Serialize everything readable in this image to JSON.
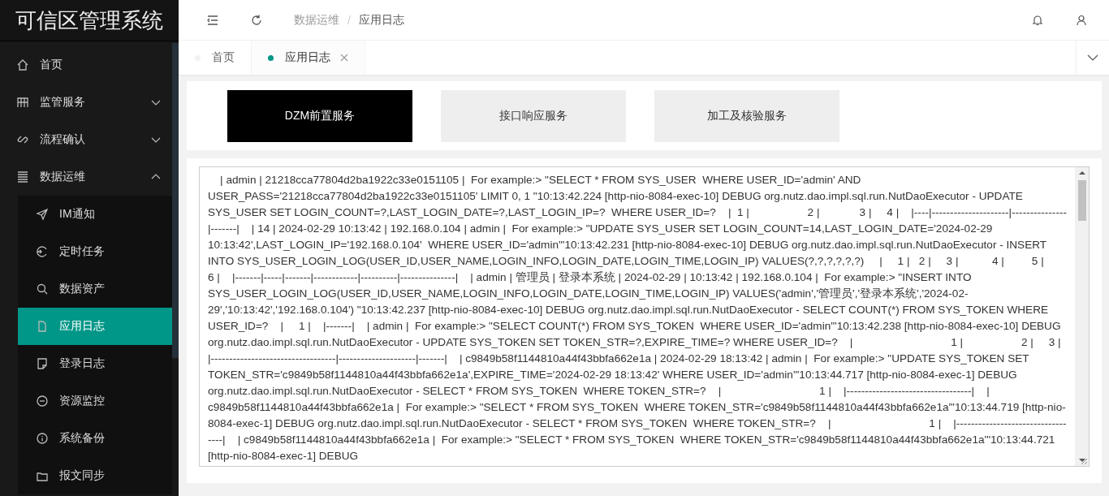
{
  "app_title": "可信区管理系统",
  "sidebar": {
    "items": [
      {
        "label": "首页",
        "kind": "item",
        "selected": false
      },
      {
        "label": "监管服务",
        "kind": "group",
        "expanded": false
      },
      {
        "label": "流程确认",
        "kind": "group",
        "expanded": false
      },
      {
        "label": "数据运维",
        "kind": "group",
        "expanded": true,
        "children": [
          {
            "label": "IM通知",
            "selected": false
          },
          {
            "label": "定时任务",
            "selected": false
          },
          {
            "label": "数据资产",
            "selected": false
          },
          {
            "label": "应用日志",
            "selected": true
          },
          {
            "label": "登录日志",
            "selected": false
          },
          {
            "label": "资源监控",
            "selected": false
          },
          {
            "label": "系统备份",
            "selected": false
          },
          {
            "label": "报文同步",
            "selected": false
          }
        ]
      }
    ]
  },
  "breadcrumb": [
    "数据运维",
    "应用日志"
  ],
  "breadcrumb_separator": "/",
  "tabs": [
    {
      "label": "首页",
      "selected": false,
      "closable": false
    },
    {
      "label": "应用日志",
      "selected": true,
      "closable": true
    }
  ],
  "services": [
    {
      "label": "DZM前置服务",
      "selected": true
    },
    {
      "label": "接口响应服务",
      "selected": false
    },
    {
      "label": "加工及核验服务",
      "selected": false
    }
  ],
  "log": "    | admin | 21218cca77804d2ba1922c33e0151105 |  For example:> \"SELECT * FROM SYS_USER  WHERE USER_ID='admin' AND USER_PASS='21218cca77804d2ba1922c33e0151105' LIMIT 0, 1 \"10:13:42.224 [http-nio-8084-exec-10] DEBUG org.nutz.dao.impl.sql.run.NutDaoExecutor - UPDATE SYS_USER SET LOGIN_COUNT=?,LAST_LOGIN_DATE=?,LAST_LOGIN_IP=?  WHERE USER_ID=?    |  1 |                   2 |             3 |     4 |    |----|---------------------|---------------|-------|    | 14 | 2024-02-29 10:13:42 | 192.168.0.104 | admin |  For example:> \"UPDATE SYS_USER SET LOGIN_COUNT=14,LAST_LOGIN_DATE='2024-02-29 10:13:42',LAST_LOGIN_IP='192.168.0.104'  WHERE USER_ID='admin'\"10:13:42.231 [http-nio-8084-exec-10] DEBUG org.nutz.dao.impl.sql.run.NutDaoExecutor - INSERT INTO SYS_USER_LOGIN_LOG(USER_ID,USER_NAME,LOGIN_INFO,LOGIN_DATE,LOGIN_TIME,LOGIN_IP) VALUES(?,?,?,?,?,?)     |     1 |   2 |     3 |           4 |         5 |             6 |    |-------|-----|-------|------------|----------|---------------|    | admin | 管理员 | 登录本系统 | 2024-02-29 | 10:13:42 | 192.168.0.104 |  For example:> \"INSERT INTO SYS_USER_LOGIN_LOG(USER_ID,USER_NAME,LOGIN_INFO,LOGIN_DATE,LOGIN_TIME,LOGIN_IP) VALUES('admin','管理员','登录本系统','2024-02-29','10:13:42','192.168.0.104') \"10:13:42.237 [http-nio-8084-exec-10] DEBUG org.nutz.dao.impl.sql.run.NutDaoExecutor - SELECT COUNT(*) FROM SYS_TOKEN WHERE USER_ID=?    |     1 |    |-------|    | admin |  For example:> \"SELECT COUNT(*) FROM SYS_TOKEN  WHERE USER_ID='admin'\"10:13:42.238 [http-nio-8084-exec-10] DEBUG org.nutz.dao.impl.sql.run.NutDaoExecutor - UPDATE SYS_TOKEN SET TOKEN_STR=?,EXPIRE_TIME=? WHERE USER_ID=?    |                                1 |                   2 |     3 |    |----------------------------------|---------------------|-------|    | c9849b58f1144810a44f43bbfa662e1a | 2024-02-29 18:13:42 | admin |  For example:> \"UPDATE SYS_TOKEN SET TOKEN_STR='c9849b58f1144810a44f43bbfa662e1a',EXPIRE_TIME='2024-02-29 18:13:42' WHERE USER_ID='admin'\"10:13:44.717 [http-nio-8084-exec-1] DEBUG org.nutz.dao.impl.sql.run.NutDaoExecutor - SELECT * FROM SYS_TOKEN  WHERE TOKEN_STR=?    |                                1 |    |----------------------------------|    | c9849b58f1144810a44f43bbfa662e1a |  For example:> \"SELECT * FROM SYS_TOKEN  WHERE TOKEN_STR='c9849b58f1144810a44f43bbfa662e1a'\"10:13:44.719 [http-nio-8084-exec-1] DEBUG org.nutz.dao.impl.sql.run.NutDaoExecutor - SELECT * FROM SYS_TOKEN  WHERE TOKEN_STR=?    |                                1 |    |----------------------------------|    | c9849b58f1144810a44f43bbfa662e1a |  For example:> \"SELECT * FROM SYS_TOKEN  WHERE TOKEN_STR='c9849b58f1144810a44f43bbfa662e1a'\"10:13:44.721 [http-nio-8084-exec-1] DEBUG"
}
